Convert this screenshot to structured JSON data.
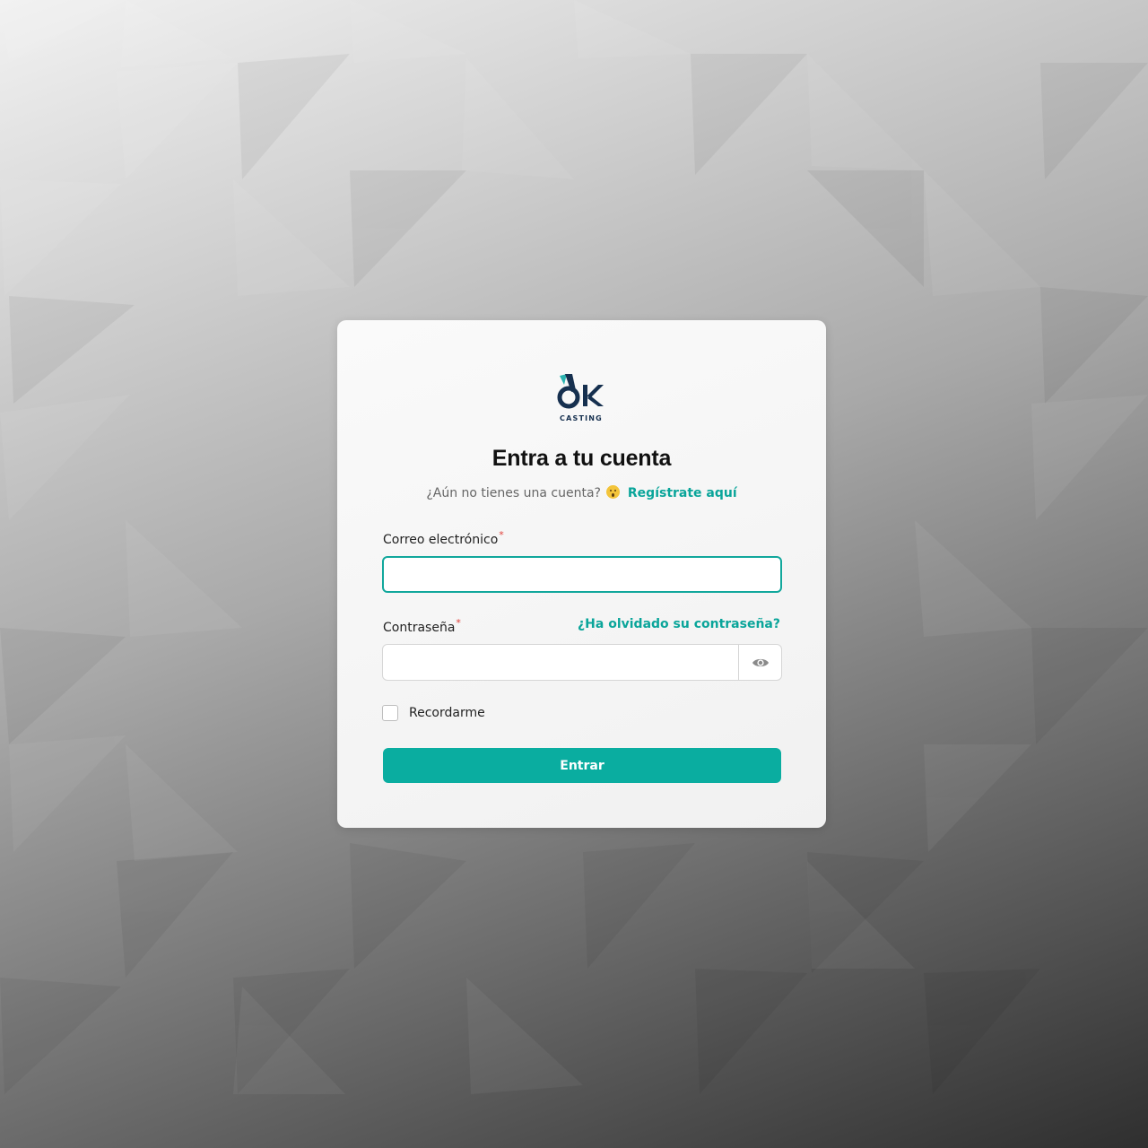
{
  "brand": {
    "logo_text": "ok",
    "logo_sub": "CASTING",
    "colors": {
      "navy": "#16304f",
      "teal": "#2bb3b0"
    }
  },
  "login": {
    "title": "Entra a tu cuenta",
    "subtitle_prefix": "¿Aún no tienes una cuenta?",
    "emoji": "astonished-face-icon",
    "register_link": "Regístrate aquí",
    "email_label": "Correo electrónico",
    "required_marker": "*",
    "email_value": "",
    "password_label": "Contraseña",
    "forgot_link": "¿Ha olvidado su contraseña?",
    "password_value": "",
    "password_toggle_icon": "eye-icon",
    "remember_label": "Recordarme",
    "remember_checked": false,
    "submit_label": "Entrar"
  },
  "colors": {
    "accent": "#0aada0",
    "link": "#0aa59a",
    "focus_border": "#11a79c",
    "required": "#e0403a",
    "title": "#111111"
  }
}
